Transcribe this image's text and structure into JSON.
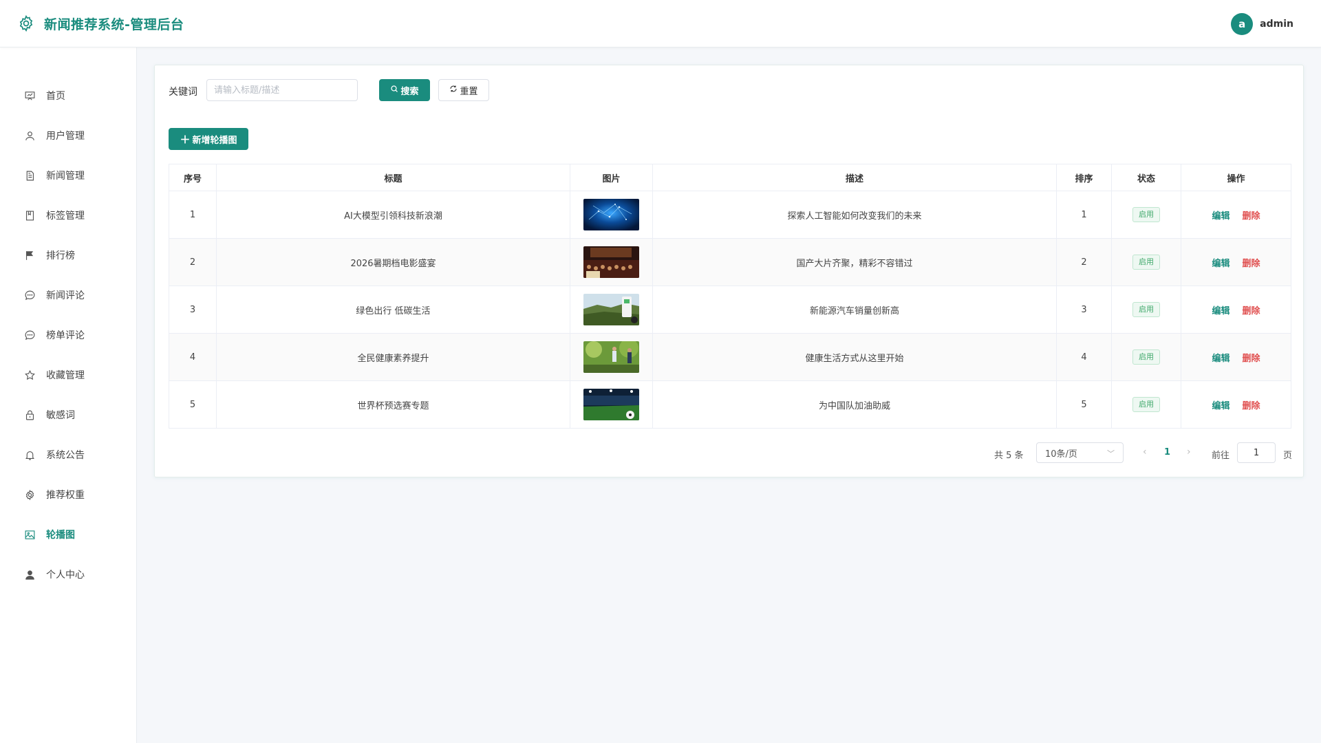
{
  "header": {
    "title": "新闻推荐系统-管理后台",
    "user": {
      "avatar_letter": "a",
      "name": "admin"
    }
  },
  "sidebar": {
    "items": [
      {
        "label": "首页",
        "icon": "presentation-icon"
      },
      {
        "label": "用户管理",
        "icon": "user-icon"
      },
      {
        "label": "新闻管理",
        "icon": "document-icon"
      },
      {
        "label": "标签管理",
        "icon": "notebook-icon"
      },
      {
        "label": "排行榜",
        "icon": "flag-icon"
      },
      {
        "label": "新闻评论",
        "icon": "chat-icon"
      },
      {
        "label": "榜单评论",
        "icon": "chat-icon"
      },
      {
        "label": "收藏管理",
        "icon": "star-icon"
      },
      {
        "label": "敏感词",
        "icon": "lock-icon"
      },
      {
        "label": "系统公告",
        "icon": "bell-icon"
      },
      {
        "label": "推荐权重",
        "icon": "gear-icon"
      },
      {
        "label": "轮播图",
        "icon": "picture-icon",
        "active": true
      },
      {
        "label": "个人中心",
        "icon": "person-icon"
      }
    ]
  },
  "search": {
    "label": "关键词",
    "placeholder": "请输入标题/描述",
    "value": "",
    "search_button": "搜索",
    "reset_button": "重置"
  },
  "toolbar": {
    "add_button": "新增轮播图"
  },
  "table": {
    "columns": [
      "序号",
      "标题",
      "图片",
      "描述",
      "排序",
      "状态",
      "操作"
    ],
    "rows": [
      {
        "index": "1",
        "title": "AI大模型引领科技新浪潮",
        "description": "探索人工智能如何改变我们的未来",
        "sort": "1",
        "status": "启用",
        "image": "ai-network-image"
      },
      {
        "index": "2",
        "title": "2026暑期档电影盛宴",
        "description": "国产大片齐聚，精彩不容错过",
        "sort": "2",
        "status": "启用",
        "image": "cinema-image"
      },
      {
        "index": "3",
        "title": "绿色出行 低碳生活",
        "description": "新能源汽车销量创新高",
        "sort": "3",
        "status": "启用",
        "image": "ev-charging-image"
      },
      {
        "index": "4",
        "title": "全民健康素养提升",
        "description": "健康生活方式从这里开始",
        "sort": "4",
        "status": "启用",
        "image": "outdoor-fitness-image"
      },
      {
        "index": "5",
        "title": "世界杯预选赛专题",
        "description": "为中国队加油助威",
        "sort": "5",
        "status": "启用",
        "image": "stadium-image"
      }
    ],
    "actions": {
      "edit": "编辑",
      "delete": "删除"
    }
  },
  "pagination": {
    "total_text": "共 5 条",
    "page_size": "10条/页",
    "current_page": "1",
    "goto_label": "前往",
    "goto_value": "1",
    "page_label": "页"
  },
  "colors": {
    "primary": "#1a8c7e",
    "danger": "#e04f4f",
    "success": "#3fa86a"
  }
}
